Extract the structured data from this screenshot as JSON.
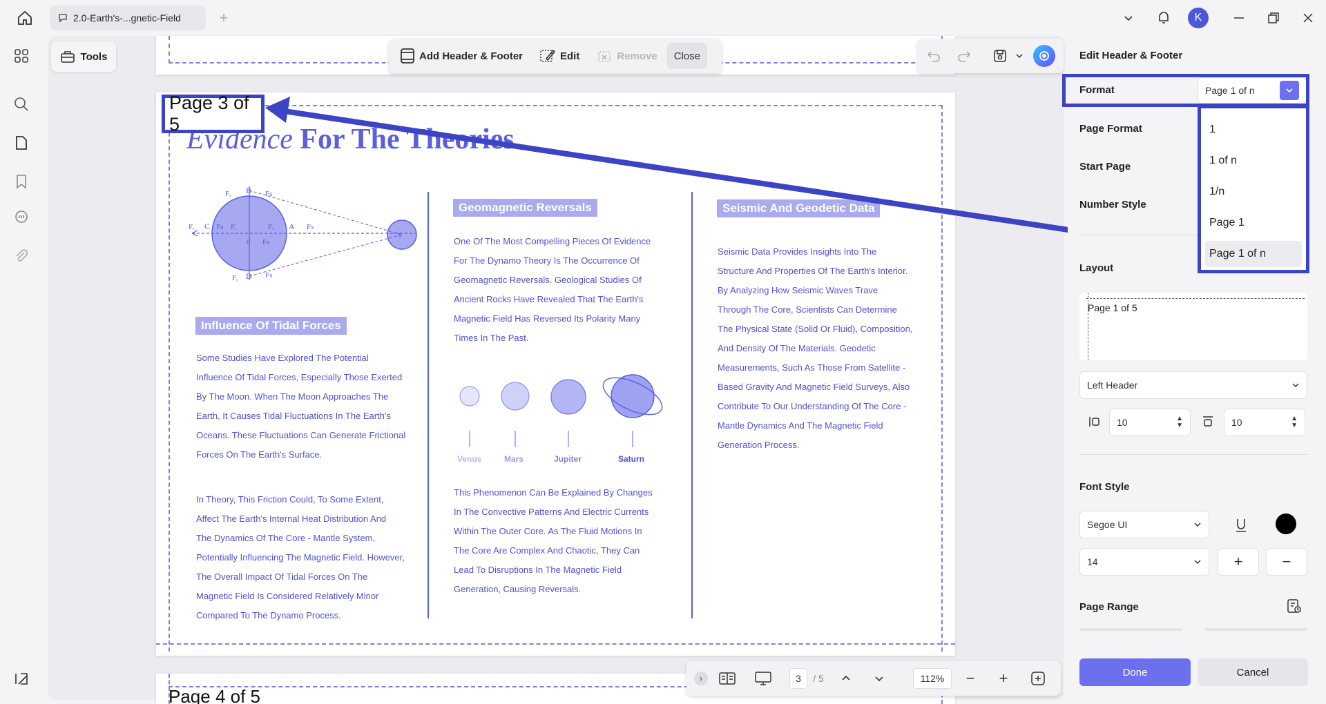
{
  "titlebar": {
    "tab_title": "2.0-Earth's-...gnetic-Field",
    "avatar_letter": "K"
  },
  "left_toolbar": {
    "tools_label": "Tools"
  },
  "header_toolbar": {
    "add_label": "Add Header & Footer",
    "edit_label": "Edit",
    "remove_label": "Remove",
    "close_label": "Close"
  },
  "page": {
    "header_text": "Page 3 of 5",
    "next_header_text": "Page 4 of 5",
    "title_italic": "Evidence",
    "title_rest": "For The Theories",
    "diagram": {
      "force_labels": [
        "Fr",
        "B",
        "Fs",
        "Fr",
        "C",
        "Fs",
        "Fr",
        "Fr",
        "A",
        "Fs",
        "0",
        "Fs",
        "Fr",
        "D",
        "Fs",
        "S"
      ]
    },
    "col1": {
      "section_title": "Influence Of Tidal Forces",
      "para1": [
        "Some Studies Have Explored The Potential",
        "Influence Of Tidal Forces, Especially Those Exerted",
        "By The Moon. When The Moon Approaches The",
        "Earth, It Causes Tidal Fluctuations In The Earth's",
        "Oceans. These Fluctuations Can Generate Frictional",
        "Forces On The Earth's Surface."
      ],
      "para2": [
        " In Theory, This Friction Could, To Some Extent,",
        "Affect The Earth's Internal Heat Distribution And",
        "The Dynamics Of The Core - Mantle System,",
        "Potentially Influencing The Magnetic Field. However,",
        "The Overall Impact Of Tidal Forces On The",
        "Magnetic Field Is Considered Relatively Minor",
        "Compared To The Dynamo Process."
      ]
    },
    "col2": {
      "section_title": "Geomagnetic Reversals",
      "para1": [
        "One Of The Most Compelling Pieces Of Evidence",
        "For The Dynamo Theory Is The Occurrence Of",
        "Geomagnetic Reversals. Geological Studies Of",
        "Ancient Rocks Have Revealed That The Earth's",
        "Magnetic Field Has Reversed Its Polarity Many",
        "Times In The Past."
      ],
      "planets": [
        "Venus",
        "Mars",
        "Jupiter",
        "Saturn"
      ],
      "para2": [
        "This Phenomenon Can Be Explained By Changes",
        "In The Convective Patterns And Electric Currents",
        "Within The Outer Core. As The Fluid Motions In",
        "The Core Are Complex And Chaotic, They Can",
        "Lead To Disruptions In The Magnetic Field",
        "Generation, Causing Reversals."
      ]
    },
    "col3": {
      "section_title": "Seismic And Geodetic Data",
      "para1": [
        "Seismic Data Provides Insights Into The",
        "Structure And Properties Of The Earth's Interior.",
        "By Analyzing How Seismic Waves Trave",
        "Through The Core, Scientists Can Determine",
        "The Physical State (Solid Or Fluid), Composition,",
        "And Density Of The Materials. Geodetic",
        "Measurements, Such As Those From Satellite -",
        "Based Gravity And Magnetic Field Surveys, Also",
        "Contribute To Our Understanding Of The Core -",
        "Mantle Dynamics And The Magnetic Field",
        "Generation Process."
      ]
    }
  },
  "navbar": {
    "current_page": "3",
    "total_pages": "/ 5",
    "zoom": "112%"
  },
  "panel": {
    "title": "Edit Header & Footer",
    "format_label": "Format",
    "format_value": "Page 1 of n",
    "format_options": [
      "1",
      "1 of n",
      "1/n",
      "Page 1",
      "Page 1 of n"
    ],
    "page_format_label": "Page Format",
    "start_page_label": "Start Page",
    "number_style_label": "Number Style",
    "layout_label": "Layout",
    "layout_preview": "Page 1 of 5",
    "position_value": "Left Header",
    "margin_left": "10",
    "margin_top": "10",
    "font_style_label": "Font Style",
    "font_value": "Segoe UI",
    "font_size": "14",
    "font_color": "#000000",
    "page_range_label": "Page Range",
    "done_label": "Done",
    "cancel_label": "Cancel"
  },
  "colors": {
    "accent": "#3b44c4",
    "doc_blue": "#5a5ee0",
    "done": "#6d70ee"
  }
}
